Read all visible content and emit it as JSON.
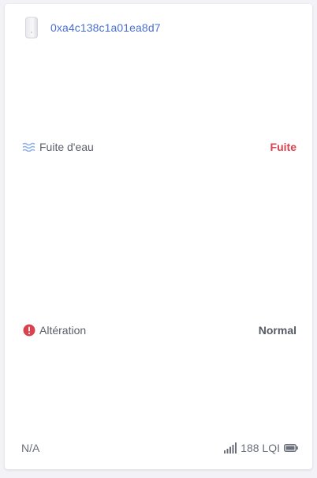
{
  "device": {
    "name": "0xa4c138c1a01ea8d7",
    "thumbnail_icon": "sensor-device-icon"
  },
  "rows": [
    {
      "icon": "water-leak-icon",
      "icon_color": "#8fb0e8",
      "label": "Fuite d'eau",
      "value": "Fuite",
      "value_color": "#d9434f"
    },
    {
      "icon": "alert-circle-icon",
      "icon_color": "#d9434f",
      "label": "Altération",
      "value": "Normal",
      "value_color": "#555a66"
    }
  ],
  "footer": {
    "last_seen": "N/A",
    "signal_icon": "signal-strength-icon",
    "lqi_text": "188 LQI",
    "battery_icon": "battery-icon"
  },
  "colors": {
    "link": "#4a6fcf",
    "alert": "#d9434f",
    "background": "#f3f3f7",
    "card": "#ffffff"
  }
}
